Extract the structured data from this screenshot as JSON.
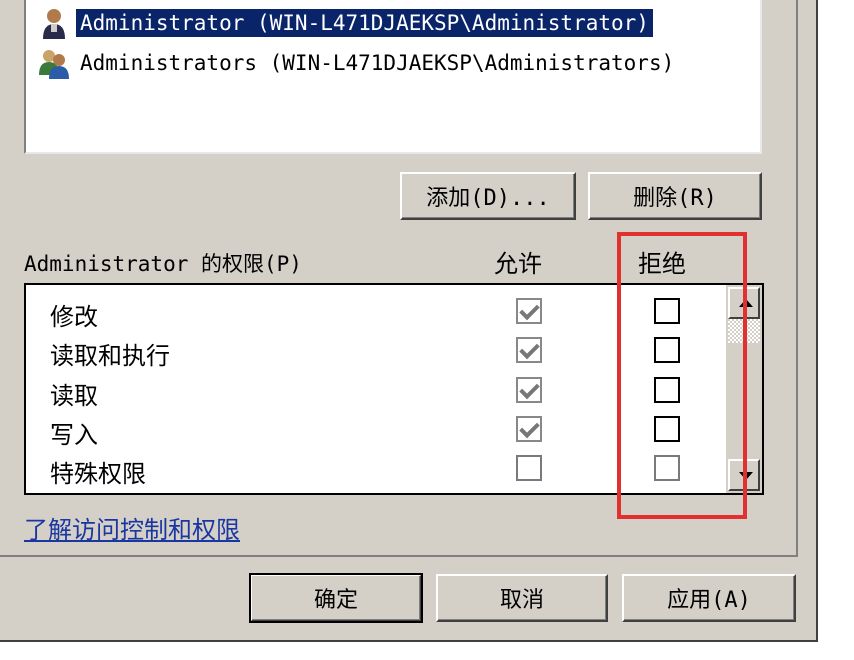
{
  "users": [
    {
      "name": "Administrator (WIN-L471DJAEKSP\\Administrator)",
      "icon": "user-icon",
      "selected": true
    },
    {
      "name": "Administrators (WIN-L471DJAEKSP\\Administrators)",
      "icon": "users-group-icon",
      "selected": false
    }
  ],
  "buttons": {
    "add": "添加(D)...",
    "remove": "删除(R)",
    "ok": "确定",
    "cancel": "取消",
    "apply": "应用(A)"
  },
  "permissions": {
    "label": "Administrator 的权限(P)",
    "allow_header": "允许",
    "deny_header": "拒绝",
    "rows": [
      {
        "name": "修改",
        "allow": "checked-disabled",
        "deny": "unchecked"
      },
      {
        "name": "读取和执行",
        "allow": "checked-disabled",
        "deny": "unchecked"
      },
      {
        "name": "读取",
        "allow": "checked-disabled",
        "deny": "unchecked"
      },
      {
        "name": "写入",
        "allow": "checked-disabled",
        "deny": "unchecked"
      },
      {
        "name": "特殊权限",
        "allow": "unchecked-disabled",
        "deny": "unchecked-disabled"
      }
    ]
  },
  "help_link": "了解访问控制和权限",
  "colors": {
    "selection": "#0a246a",
    "highlight_frame": "#e03030",
    "link": "#1a36a0",
    "dialog_bg": "#d4d0c8"
  }
}
